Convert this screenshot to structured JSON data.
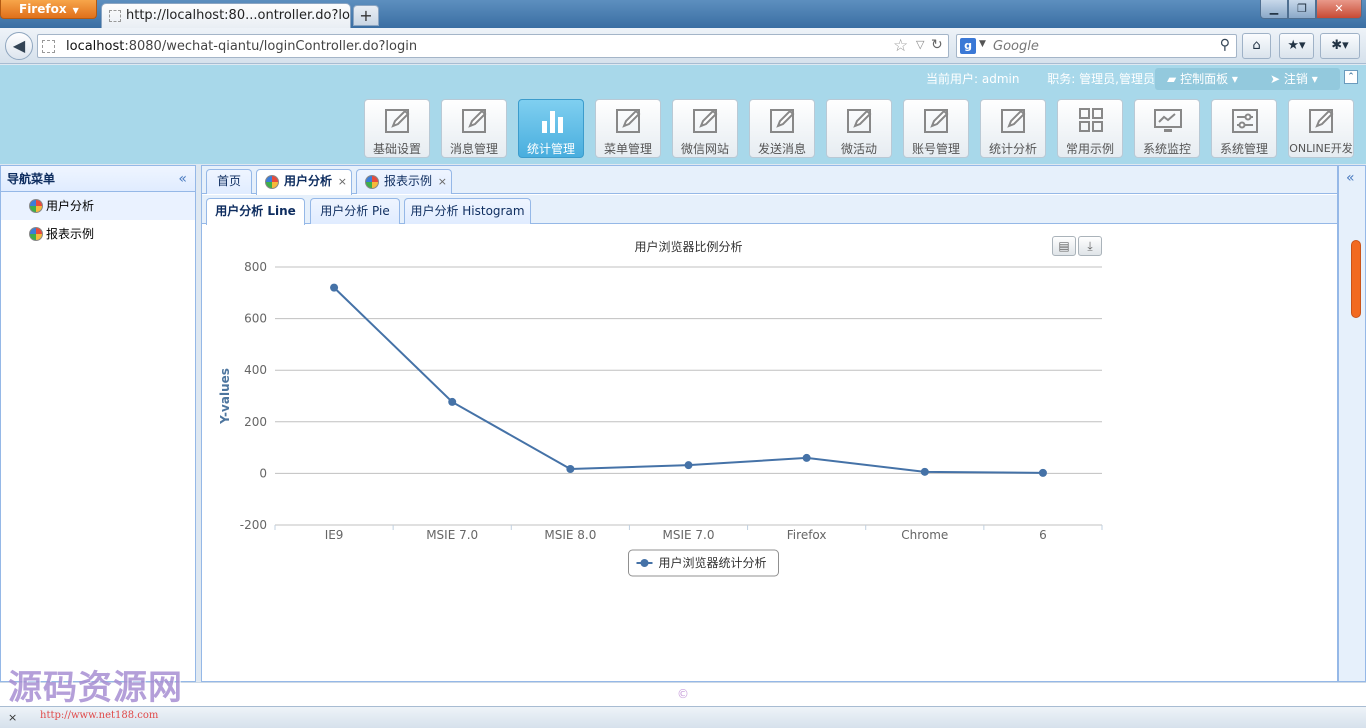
{
  "browser": {
    "app_button": "Firefox",
    "tab_title": "http://localhost:80...ontroller.do?login",
    "new_tab": "+",
    "url_host": "localhost",
    "url_rest": ":8080/wechat-qiantu/loginController.do?login",
    "search_placeholder": "Google",
    "minimize": "▁",
    "maximize": "❐",
    "close": "✕"
  },
  "header": {
    "current_user": "当前用户: admin",
    "job": "职务: 管理员,管理员",
    "control_panel": "控制面板",
    "logout": "注销",
    "menu": [
      {
        "label": "基础设置",
        "icon": "edit-icon"
      },
      {
        "label": "消息管理",
        "icon": "edit-icon"
      },
      {
        "label": "统计管理",
        "icon": "bar-chart-icon"
      },
      {
        "label": "菜单管理",
        "icon": "edit-icon"
      },
      {
        "label": "微信网站",
        "icon": "edit-icon"
      },
      {
        "label": "发送消息",
        "icon": "edit-icon"
      },
      {
        "label": "微活动",
        "icon": "edit-icon"
      },
      {
        "label": "账号管理",
        "icon": "edit-icon"
      },
      {
        "label": "统计分析",
        "icon": "edit-icon"
      },
      {
        "label": "常用示例",
        "icon": "grid-icon"
      },
      {
        "label": "系统监控",
        "icon": "monitor-icon"
      },
      {
        "label": "系统管理",
        "icon": "sliders-icon"
      },
      {
        "label": "ONLINE开发",
        "icon": "edit-icon"
      }
    ],
    "active_menu": "统计管理"
  },
  "leftnav": {
    "title": "导航菜单",
    "items": [
      {
        "label": "用户分析"
      },
      {
        "label": "报表示例"
      }
    ]
  },
  "tabs": {
    "home": "首页",
    "user_analysis": "用户分析",
    "report_example": "报表示例",
    "close_glyph": "×"
  },
  "subtabs": {
    "line": "用户分析 Line",
    "pie": "用户分析 Pie",
    "histogram": "用户分析 Histogram"
  },
  "chart_data": {
    "type": "line",
    "title": "用户浏览器比例分析",
    "xlabel": "",
    "ylabel": "Y-values",
    "categories": [
      "IE9",
      "MSIE 7.0",
      "MSIE 8.0",
      "MSIE 7.0",
      "Firefox",
      "Chrome",
      "6"
    ],
    "series": [
      {
        "name": "用户浏览器统计分析",
        "values": [
          720,
          277,
          17,
          32,
          60,
          6,
          2
        ],
        "color": "#4572a7"
      }
    ],
    "ylim": [
      -200,
      800
    ],
    "yticks": [
      "800",
      "600",
      "400",
      "200",
      "0",
      "-200"
    ],
    "grid": true,
    "legend_position": "bottom"
  },
  "footer": {
    "copyright": "©"
  },
  "watermark": {
    "text": "源码资源网",
    "url": "http://www.net188.com"
  },
  "statusbar": {
    "close": "×"
  }
}
